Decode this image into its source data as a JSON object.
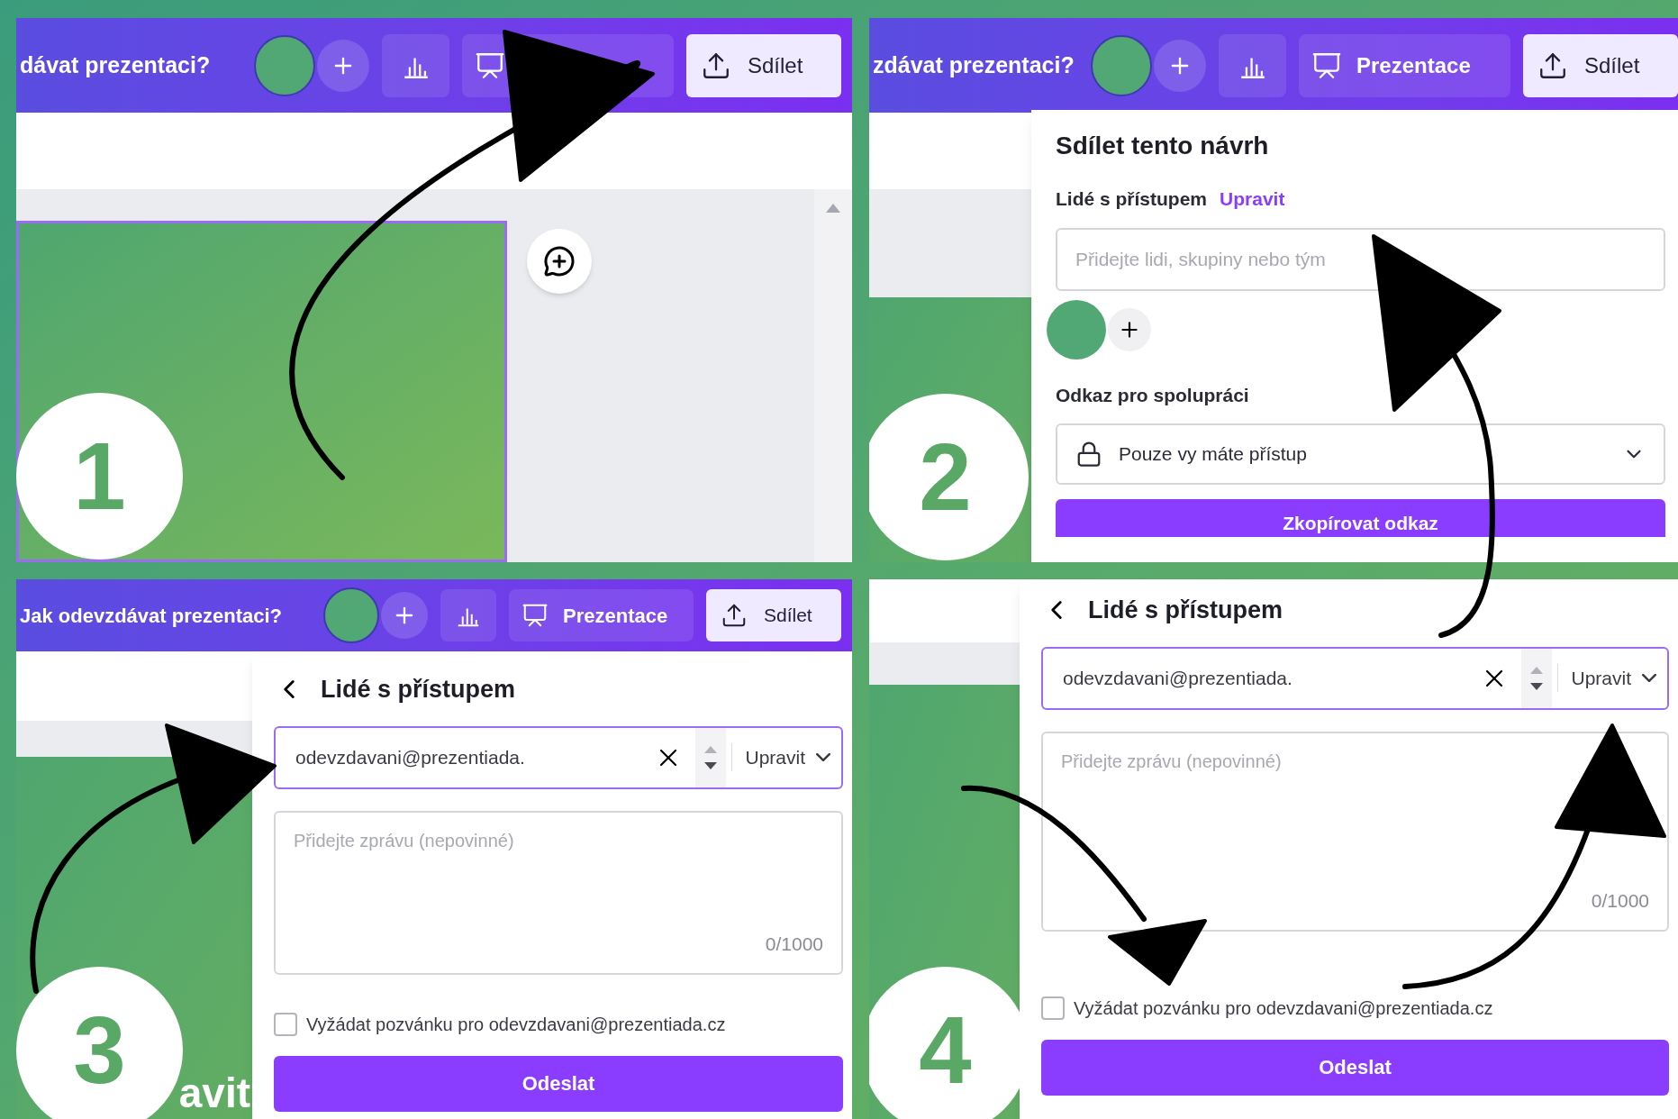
{
  "panels": [
    {
      "step": "1",
      "kind": "editor",
      "header": {
        "title": "dávat prezentaci?",
        "share_label": "Sdílet"
      }
    },
    {
      "step": "2",
      "kind": "share",
      "header": {
        "title": "zdávat prezentaci?",
        "present_label": "Prezentace",
        "share_label": "Sdílet"
      },
      "dialog": {
        "title": "Sdílet tento návrh",
        "people_label": "Lidé s přístupem",
        "edit_link": "Upravit",
        "placeholder": "Přidejte lidi, skupiny nebo tým",
        "link_label": "Odkaz pro spolupráci",
        "access": "Pouze vy máte přístup",
        "copy_button": "Zkopírovat odkaz"
      }
    },
    {
      "step": "3",
      "kind": "people",
      "header": {
        "title": "Jak odevzdávat prezentaci?",
        "present_label": "Prezentace",
        "share_label": "Sdílet"
      },
      "slide_text": "avit",
      "dialog": {
        "title": "Lidé s přístupem",
        "email": "odevzdavani@prezentiada.",
        "role": "Upravit",
        "message_placeholder": "Přidejte zprávu (nepovinné)",
        "counter": "0/1000",
        "invite_label": "Vyžádat pozvánku pro odevzdavani@prezentiada.cz",
        "invite_checked": false,
        "send_button": "Odeslat"
      }
    },
    {
      "step": "4",
      "kind": "people",
      "dialog": {
        "title": "Lidé s přístupem",
        "email": "odevzdavani@prezentiada.",
        "role": "Upravit",
        "message_placeholder": "Přidejte zprávu (nepovinné)",
        "counter": "0/1000",
        "invite_label": "Vyžádat pozvánku pro odevzdavani@prezentiada.cz",
        "invite_checked": false,
        "send_button": "Odeslat"
      }
    }
  ]
}
